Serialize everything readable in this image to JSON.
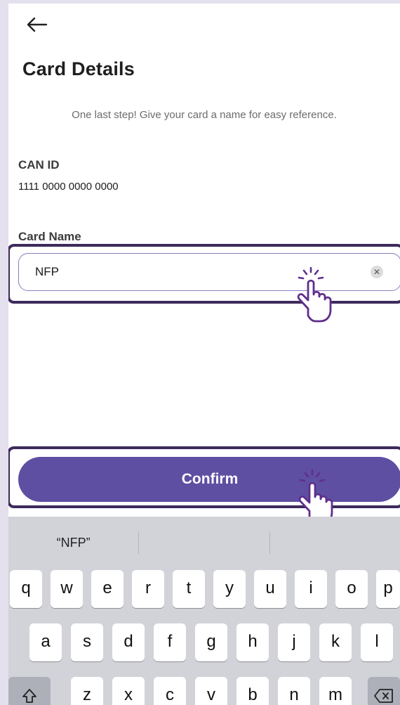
{
  "header": {
    "back_icon": "arrow-left-icon",
    "title": "Card Details"
  },
  "subtitle": "One last step! Give your card a name for easy reference.",
  "can": {
    "label": "CAN ID",
    "value": "1111 0000 0000 0000"
  },
  "card_name": {
    "label": "Card Name",
    "value": "NFP",
    "clear_icon": "clear-circle-icon"
  },
  "confirm_button": {
    "label": "Confirm"
  },
  "keyboard": {
    "suggestions": [
      "“NFP”",
      "",
      ""
    ],
    "rows": [
      [
        "q",
        "w",
        "e",
        "r",
        "t",
        "y",
        "u",
        "i",
        "o",
        "p"
      ],
      [
        "a",
        "s",
        "d",
        "f",
        "g",
        "h",
        "j",
        "k",
        "l"
      ],
      [
        "z",
        "x",
        "c",
        "v",
        "b",
        "n",
        "m"
      ]
    ],
    "shift_icon": "shift-icon",
    "backspace_icon": "backspace-icon"
  },
  "colors": {
    "accent": "#5e4fa2",
    "highlight_border": "#3d2a5c",
    "input_border": "#8f7bc0",
    "keyboard_bg": "#d1d3d9",
    "page_bg": "#e4e0ee"
  }
}
